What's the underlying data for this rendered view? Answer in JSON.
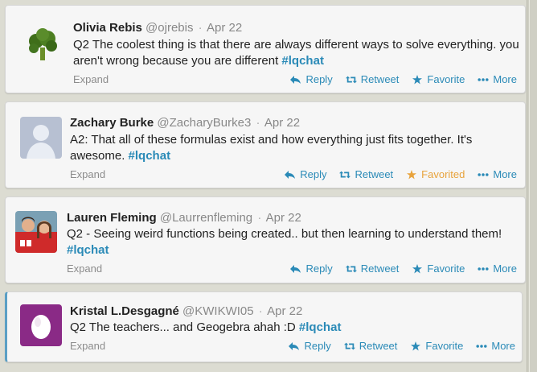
{
  "tweets": [
    {
      "name": "Olivia Rebis",
      "handle": "@ojrebis",
      "date": "Apr 22",
      "text": "Q2 The coolest thing is that there are always different ways to solve everything. you aren't wrong because you are different",
      "hashtag": "#lqchat",
      "expand": "Expand",
      "reply": "Reply",
      "retweet": "Retweet",
      "favorite": "Favorite",
      "more": "More",
      "favorited": false,
      "avatar_icon": "broccoli-avatar-icon"
    },
    {
      "name": "Zachary Burke",
      "handle": "@ZacharyBurke3",
      "date": "Apr 22",
      "text": "A2: That all of these formulas exist and how everything just fits together. It's awesome.",
      "hashtag": "#lqchat",
      "expand": "Expand",
      "reply": "Reply",
      "retweet": "Retweet",
      "favorite": "Favorited",
      "more": "More",
      "favorited": true,
      "avatar_icon": "default-user-avatar-icon"
    },
    {
      "name": "Lauren Fleming",
      "handle": "@Laurrenfleming",
      "date": "Apr 22",
      "text": "Q2 - Seeing weird functions being created.. but then learning to understand them!",
      "hashtag": "#lqchat",
      "expand": "Expand",
      "reply": "Reply",
      "retweet": "Retweet",
      "favorite": "Favorite",
      "more": "More",
      "favorited": false,
      "avatar_icon": "photo-avatar-icon"
    },
    {
      "name": "Kristal L.Desgagné",
      "handle": "@KWIKWI05",
      "date": "Apr 22",
      "text": "Q2 The teachers... and Geogebra ahah :D",
      "hashtag": "#lqchat",
      "expand": "Expand",
      "reply": "Reply",
      "retweet": "Retweet",
      "favorite": "Favorite",
      "more": "More",
      "favorited": false,
      "avatar_icon": "egg-avatar-icon"
    }
  ],
  "colors": {
    "link": "#2a8ab7",
    "favorited": "#e8a33c",
    "highlight_border": "#5a9fc5"
  }
}
